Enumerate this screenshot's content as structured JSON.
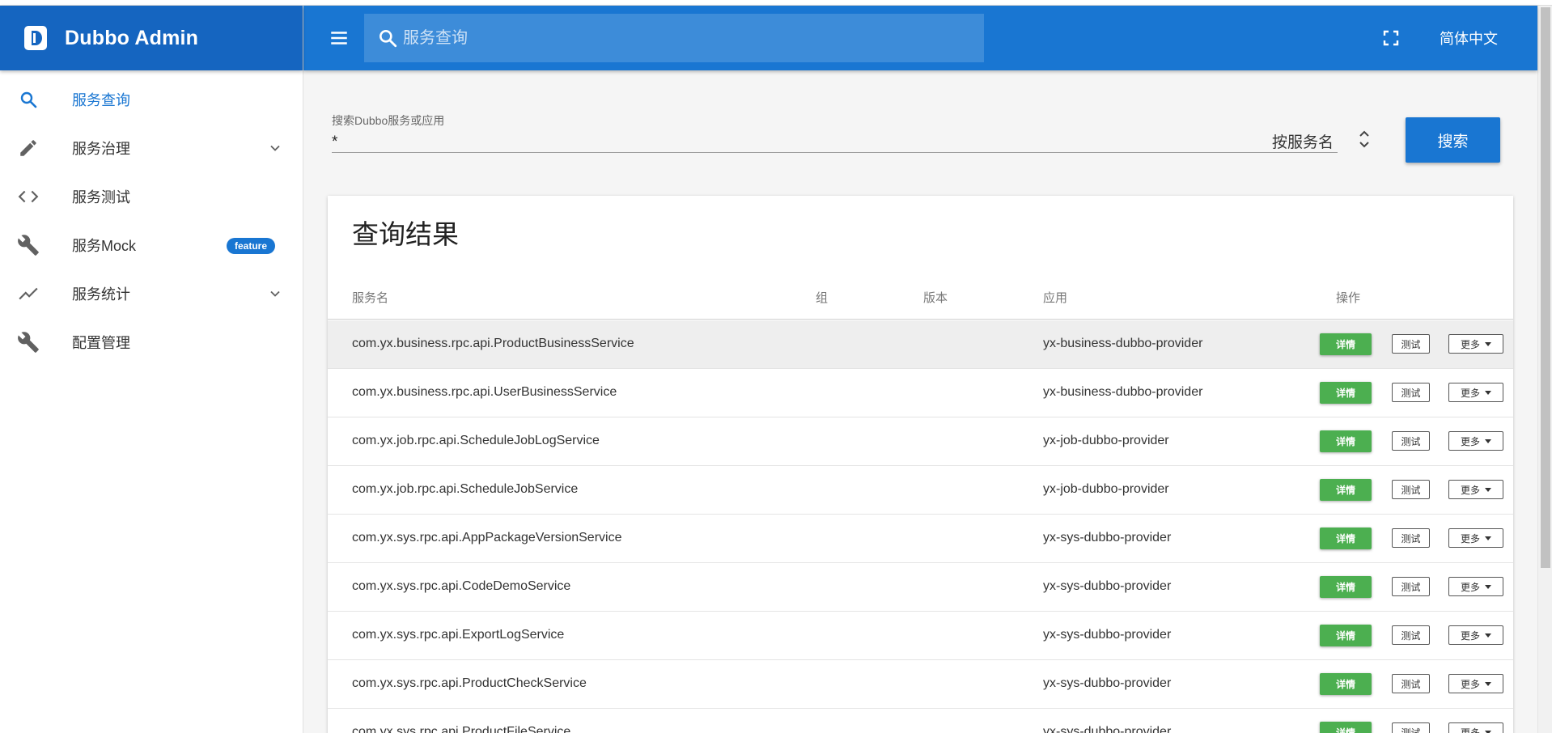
{
  "brand": {
    "title": "Dubbo Admin"
  },
  "sidebar": {
    "items": [
      {
        "label": "服务查询",
        "icon": "search-icon"
      },
      {
        "label": "服务治理",
        "icon": "pencil-icon"
      },
      {
        "label": "服务测试",
        "icon": "code-icon"
      },
      {
        "label": "服务Mock",
        "icon": "wrench-icon",
        "badge": "feature"
      },
      {
        "label": "服务统计",
        "icon": "trending-up-icon"
      },
      {
        "label": "配置管理",
        "icon": "wrench-icon"
      }
    ]
  },
  "topbar": {
    "search_placeholder": "服务查询",
    "language": "简体中文"
  },
  "search": {
    "label": "搜索Dubbo服务或应用",
    "value": "*",
    "mode": "按服务名",
    "button": "搜索"
  },
  "results": {
    "title": "查询结果",
    "columns": {
      "service": "服务名",
      "group": "组",
      "version": "版本",
      "app": "应用",
      "ops": "操作"
    },
    "actions": {
      "detail": "详情",
      "test": "测试",
      "more": "更多"
    },
    "rows": [
      {
        "service": "com.yx.business.rpc.api.ProductBusinessService",
        "app": "yx-business-dubbo-provider"
      },
      {
        "service": "com.yx.business.rpc.api.UserBusinessService",
        "app": "yx-business-dubbo-provider"
      },
      {
        "service": "com.yx.job.rpc.api.ScheduleJobLogService",
        "app": "yx-job-dubbo-provider"
      },
      {
        "service": "com.yx.job.rpc.api.ScheduleJobService",
        "app": "yx-job-dubbo-provider"
      },
      {
        "service": "com.yx.sys.rpc.api.AppPackageVersionService",
        "app": "yx-sys-dubbo-provider"
      },
      {
        "service": "com.yx.sys.rpc.api.CodeDemoService",
        "app": "yx-sys-dubbo-provider"
      },
      {
        "service": "com.yx.sys.rpc.api.ExportLogService",
        "app": "yx-sys-dubbo-provider"
      },
      {
        "service": "com.yx.sys.rpc.api.ProductCheckService",
        "app": "yx-sys-dubbo-provider"
      },
      {
        "service": "com.yx.sys.rpc.api.ProductFileService",
        "app": "yx-sys-dubbo-provider"
      }
    ]
  },
  "colors": {
    "primary": "#1976d2",
    "brand_dark": "#1565c0",
    "success": "#4caf50"
  }
}
